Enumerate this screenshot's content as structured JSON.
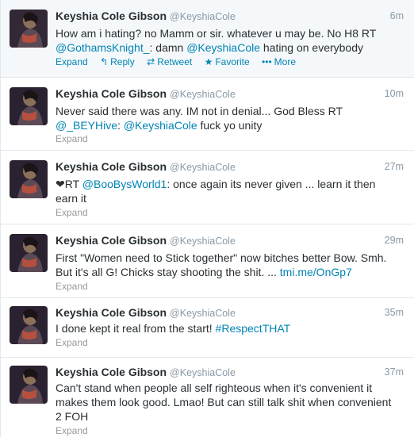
{
  "tweets": [
    {
      "name": "Keyshia Cole Gibson",
      "handle": "@KeyshiaCole",
      "time": "6m",
      "line1": "How am i hating? no Mamm or sir. whatever u may be. No H8  RT",
      "line2_link1": "@GothamsKnight_",
      "line2_mid": ": damn ",
      "line2_link2": "@KeyshiaCole",
      "line2_end": " hating on everybody",
      "actions": {
        "expand": "Expand",
        "reply": "Reply",
        "retweet": "Retweet",
        "favorite": "Favorite",
        "more": "More"
      }
    },
    {
      "name": "Keyshia Cole Gibson",
      "handle": "@KeyshiaCole",
      "time": "10m",
      "line1": "Never said there was any. IM not in denial... God Bless RT",
      "line2_link1": "@_BEYHive",
      "line2_mid": ": ",
      "line2_link2": "@KeyshiaCole",
      "line2_end": " fuck yo unity",
      "expand": "Expand"
    },
    {
      "name": "Keyshia Cole Gibson",
      "handle": "@KeyshiaCole",
      "time": "27m",
      "line1_pre": "❤RT ",
      "line1_link": "@BooBysWorld1",
      "line1_end": ": once again its never given ... learn it then",
      "line2": "earn it",
      "expand": "Expand"
    },
    {
      "name": "Keyshia Cole Gibson",
      "handle": "@KeyshiaCole",
      "time": "29m",
      "line1": "First \"Women need to Stick together\" now bitches better Bow. Smh.",
      "line2_pre": "But it's all G! Chicks stay shooting the shit. ... ",
      "line2_link": "tmi.me/OnGp7",
      "expand": "Expand"
    },
    {
      "name": "Keyshia Cole Gibson",
      "handle": "@KeyshiaCole",
      "time": "35m",
      "line1_pre": "I done kept it real from the start! ",
      "line1_link": "#RespectTHAT",
      "expand": "Expand"
    },
    {
      "name": "Keyshia Cole Gibson",
      "handle": "@KeyshiaCole",
      "time": "37m",
      "line1": "Can't stand when people all self righteous when it's convenient it",
      "line2": "makes them look good. Lmao! But can still talk shit when convenient",
      "line3": "2 FOH",
      "expand": "Expand"
    }
  ]
}
